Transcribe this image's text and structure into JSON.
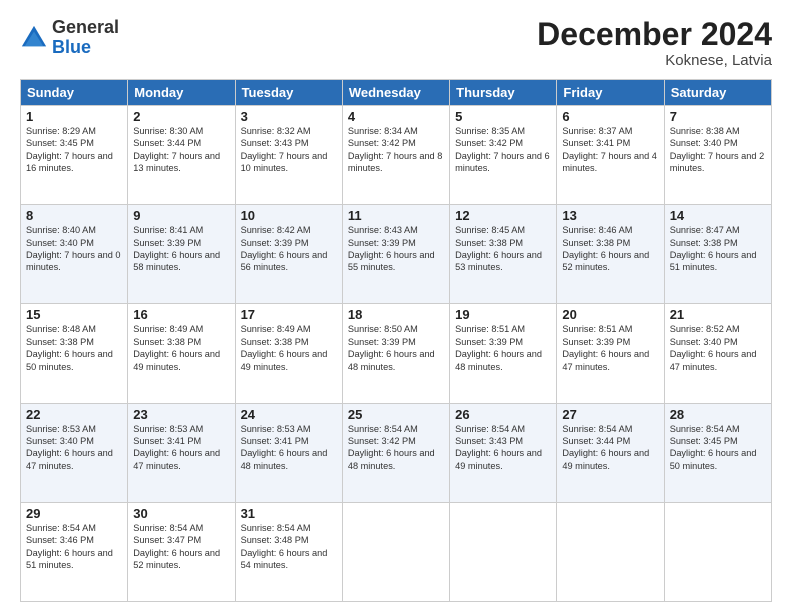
{
  "header": {
    "logo_general": "General",
    "logo_blue": "Blue",
    "month_title": "December 2024",
    "location": "Koknese, Latvia"
  },
  "days_of_week": [
    "Sunday",
    "Monday",
    "Tuesday",
    "Wednesday",
    "Thursday",
    "Friday",
    "Saturday"
  ],
  "weeks": [
    [
      {
        "day": "1",
        "sunrise": "Sunrise: 8:29 AM",
        "sunset": "Sunset: 3:45 PM",
        "daylight": "Daylight: 7 hours and 16 minutes."
      },
      {
        "day": "2",
        "sunrise": "Sunrise: 8:30 AM",
        "sunset": "Sunset: 3:44 PM",
        "daylight": "Daylight: 7 hours and 13 minutes."
      },
      {
        "day": "3",
        "sunrise": "Sunrise: 8:32 AM",
        "sunset": "Sunset: 3:43 PM",
        "daylight": "Daylight: 7 hours and 10 minutes."
      },
      {
        "day": "4",
        "sunrise": "Sunrise: 8:34 AM",
        "sunset": "Sunset: 3:42 PM",
        "daylight": "Daylight: 7 hours and 8 minutes."
      },
      {
        "day": "5",
        "sunrise": "Sunrise: 8:35 AM",
        "sunset": "Sunset: 3:42 PM",
        "daylight": "Daylight: 7 hours and 6 minutes."
      },
      {
        "day": "6",
        "sunrise": "Sunrise: 8:37 AM",
        "sunset": "Sunset: 3:41 PM",
        "daylight": "Daylight: 7 hours and 4 minutes."
      },
      {
        "day": "7",
        "sunrise": "Sunrise: 8:38 AM",
        "sunset": "Sunset: 3:40 PM",
        "daylight": "Daylight: 7 hours and 2 minutes."
      }
    ],
    [
      {
        "day": "8",
        "sunrise": "Sunrise: 8:40 AM",
        "sunset": "Sunset: 3:40 PM",
        "daylight": "Daylight: 7 hours and 0 minutes."
      },
      {
        "day": "9",
        "sunrise": "Sunrise: 8:41 AM",
        "sunset": "Sunset: 3:39 PM",
        "daylight": "Daylight: 6 hours and 58 minutes."
      },
      {
        "day": "10",
        "sunrise": "Sunrise: 8:42 AM",
        "sunset": "Sunset: 3:39 PM",
        "daylight": "Daylight: 6 hours and 56 minutes."
      },
      {
        "day": "11",
        "sunrise": "Sunrise: 8:43 AM",
        "sunset": "Sunset: 3:39 PM",
        "daylight": "Daylight: 6 hours and 55 minutes."
      },
      {
        "day": "12",
        "sunrise": "Sunrise: 8:45 AM",
        "sunset": "Sunset: 3:38 PM",
        "daylight": "Daylight: 6 hours and 53 minutes."
      },
      {
        "day": "13",
        "sunrise": "Sunrise: 8:46 AM",
        "sunset": "Sunset: 3:38 PM",
        "daylight": "Daylight: 6 hours and 52 minutes."
      },
      {
        "day": "14",
        "sunrise": "Sunrise: 8:47 AM",
        "sunset": "Sunset: 3:38 PM",
        "daylight": "Daylight: 6 hours and 51 minutes."
      }
    ],
    [
      {
        "day": "15",
        "sunrise": "Sunrise: 8:48 AM",
        "sunset": "Sunset: 3:38 PM",
        "daylight": "Daylight: 6 hours and 50 minutes."
      },
      {
        "day": "16",
        "sunrise": "Sunrise: 8:49 AM",
        "sunset": "Sunset: 3:38 PM",
        "daylight": "Daylight: 6 hours and 49 minutes."
      },
      {
        "day": "17",
        "sunrise": "Sunrise: 8:49 AM",
        "sunset": "Sunset: 3:38 PM",
        "daylight": "Daylight: 6 hours and 49 minutes."
      },
      {
        "day": "18",
        "sunrise": "Sunrise: 8:50 AM",
        "sunset": "Sunset: 3:39 PM",
        "daylight": "Daylight: 6 hours and 48 minutes."
      },
      {
        "day": "19",
        "sunrise": "Sunrise: 8:51 AM",
        "sunset": "Sunset: 3:39 PM",
        "daylight": "Daylight: 6 hours and 48 minutes."
      },
      {
        "day": "20",
        "sunrise": "Sunrise: 8:51 AM",
        "sunset": "Sunset: 3:39 PM",
        "daylight": "Daylight: 6 hours and 47 minutes."
      },
      {
        "day": "21",
        "sunrise": "Sunrise: 8:52 AM",
        "sunset": "Sunset: 3:40 PM",
        "daylight": "Daylight: 6 hours and 47 minutes."
      }
    ],
    [
      {
        "day": "22",
        "sunrise": "Sunrise: 8:53 AM",
        "sunset": "Sunset: 3:40 PM",
        "daylight": "Daylight: 6 hours and 47 minutes."
      },
      {
        "day": "23",
        "sunrise": "Sunrise: 8:53 AM",
        "sunset": "Sunset: 3:41 PM",
        "daylight": "Daylight: 6 hours and 47 minutes."
      },
      {
        "day": "24",
        "sunrise": "Sunrise: 8:53 AM",
        "sunset": "Sunset: 3:41 PM",
        "daylight": "Daylight: 6 hours and 48 minutes."
      },
      {
        "day": "25",
        "sunrise": "Sunrise: 8:54 AM",
        "sunset": "Sunset: 3:42 PM",
        "daylight": "Daylight: 6 hours and 48 minutes."
      },
      {
        "day": "26",
        "sunrise": "Sunrise: 8:54 AM",
        "sunset": "Sunset: 3:43 PM",
        "daylight": "Daylight: 6 hours and 49 minutes."
      },
      {
        "day": "27",
        "sunrise": "Sunrise: 8:54 AM",
        "sunset": "Sunset: 3:44 PM",
        "daylight": "Daylight: 6 hours and 49 minutes."
      },
      {
        "day": "28",
        "sunrise": "Sunrise: 8:54 AM",
        "sunset": "Sunset: 3:45 PM",
        "daylight": "Daylight: 6 hours and 50 minutes."
      }
    ],
    [
      {
        "day": "29",
        "sunrise": "Sunrise: 8:54 AM",
        "sunset": "Sunset: 3:46 PM",
        "daylight": "Daylight: 6 hours and 51 minutes."
      },
      {
        "day": "30",
        "sunrise": "Sunrise: 8:54 AM",
        "sunset": "Sunset: 3:47 PM",
        "daylight": "Daylight: 6 hours and 52 minutes."
      },
      {
        "day": "31",
        "sunrise": "Sunrise: 8:54 AM",
        "sunset": "Sunset: 3:48 PM",
        "daylight": "Daylight: 6 hours and 54 minutes."
      },
      null,
      null,
      null,
      null
    ]
  ]
}
